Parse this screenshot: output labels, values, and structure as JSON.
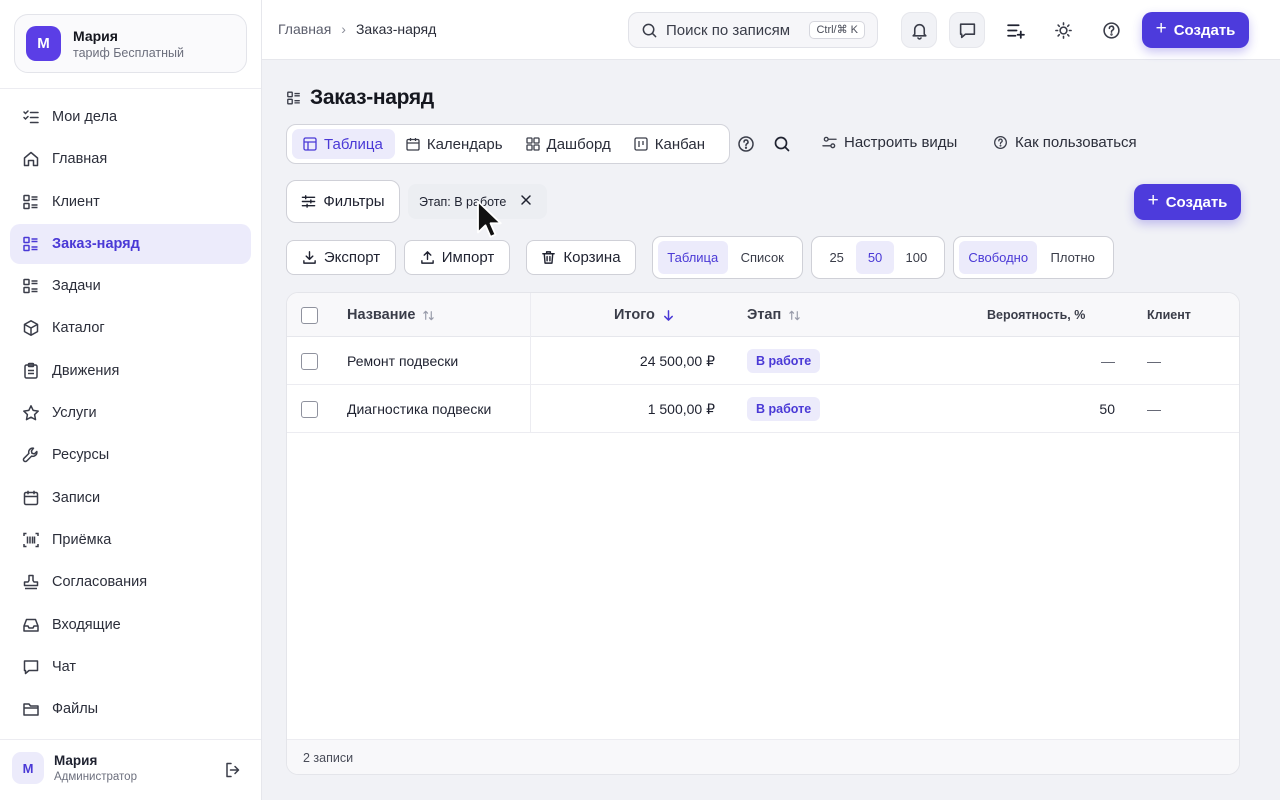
{
  "sidebar": {
    "user": {
      "initial": "М",
      "name": "Мария",
      "plan": "тариф Бесплатный"
    },
    "items": [
      {
        "label": "Мои дела",
        "icon": "checklist-icon"
      },
      {
        "label": "Главная",
        "icon": "home-icon"
      },
      {
        "label": "Клиент",
        "icon": "list-icon"
      },
      {
        "label": "Заказ-наряд",
        "icon": "list-icon",
        "active": true
      },
      {
        "label": "Задачи",
        "icon": "list-icon"
      },
      {
        "label": "Каталог",
        "icon": "box-icon"
      },
      {
        "label": "Движения",
        "icon": "clipboard-icon"
      },
      {
        "label": "Услуги",
        "icon": "star-icon"
      },
      {
        "label": "Ресурсы",
        "icon": "wrench-icon"
      },
      {
        "label": "Записи",
        "icon": "calendar-icon"
      },
      {
        "label": "Приёмка",
        "icon": "barcode-icon"
      },
      {
        "label": "Согласования",
        "icon": "stamp-icon"
      },
      {
        "label": "Входящие",
        "icon": "inbox-icon"
      },
      {
        "label": "Чат",
        "icon": "chat-icon"
      },
      {
        "label": "Файлы",
        "icon": "folder-icon"
      }
    ],
    "footer_user": {
      "initial": "М",
      "name": "Мария",
      "role": "Администратор"
    }
  },
  "header": {
    "breadcrumbs": [
      "Главная",
      "Заказ-наряд"
    ],
    "search_placeholder": "Поиск по записям",
    "search_shortcut": "Ctrl/⌘ K",
    "create_label": "Создать"
  },
  "main": {
    "title": "Заказ-наряд",
    "view_tabs": [
      {
        "label": "Таблица",
        "icon": "table-icon",
        "active": true
      },
      {
        "label": "Календарь",
        "icon": "calendar-icon"
      },
      {
        "label": "Дашборд",
        "icon": "dashboard-icon"
      },
      {
        "label": "Канбан",
        "icon": "kanban-icon"
      }
    ],
    "configure_views_label": "Настроить виды",
    "how_to_label": "Как пользоваться",
    "filters_label": "Фильтры",
    "active_filter": "Этап: В работе",
    "create_label": "Создать",
    "export_label": "Экспорт",
    "import_label": "Импорт",
    "trash_label": "Корзина",
    "display_mode": {
      "options": [
        "Таблица",
        "Список"
      ],
      "selected": "Таблица"
    },
    "page_size": {
      "options": [
        "25",
        "50",
        "100"
      ],
      "selected": "50"
    },
    "density": {
      "options": [
        "Свободно",
        "Плотно"
      ],
      "selected": "Свободно"
    },
    "table": {
      "columns": [
        "Название",
        "Итого",
        "Этап",
        "Вероятность, %",
        "Клиент"
      ],
      "sort": {
        "column": "Итого",
        "direction": "desc"
      },
      "rows": [
        {
          "name": "Ремонт подвески",
          "total": "24 500,00 ₽",
          "stage": "В работе",
          "probability": "—",
          "client": "—"
        },
        {
          "name": "Диагностика подвески",
          "total": "1 500,00 ₽",
          "stage": "В работе",
          "probability": "50",
          "client": "—"
        }
      ],
      "footer": "2 записи"
    }
  },
  "colors": {
    "accent": "#4d3bdc",
    "accent_soft": "#ecebfb",
    "accent_text": "#4a39d6",
    "background": "#f1f2f6"
  }
}
